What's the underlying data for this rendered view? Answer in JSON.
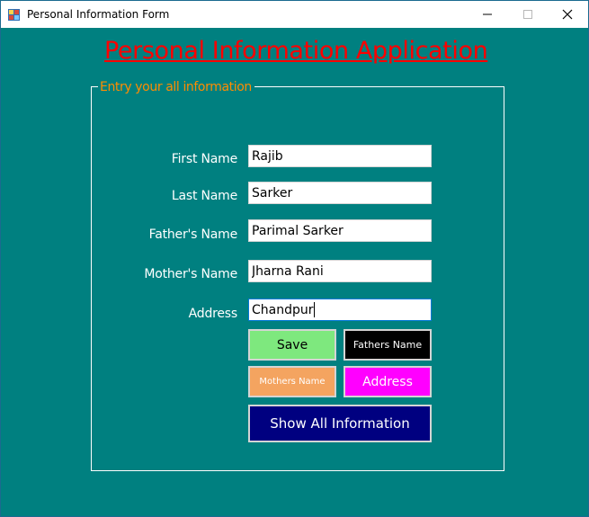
{
  "window": {
    "title": "Personal Information Form",
    "icon": "form-app-icon",
    "controls": {
      "minimize": "minimize-icon",
      "maximize": "maximize-icon",
      "close": "close-icon"
    }
  },
  "header": {
    "title": "Personal Information Application"
  },
  "group": {
    "legend": "Entry your all information"
  },
  "fields": {
    "first_name": {
      "label": "First Name",
      "value": "Rajib"
    },
    "last_name": {
      "label": "Last Name",
      "value": "Sarker"
    },
    "father_name": {
      "label": "Father's Name",
      "value": "Parimal Sarker"
    },
    "mother_name": {
      "label": "Mother's Name",
      "value": "Jharna Rani"
    },
    "address": {
      "label": "Address",
      "value": "Chandpur"
    }
  },
  "buttons": {
    "save": "Save",
    "fathers_name": "Fathers Name",
    "mothers_name": "Mothers Name",
    "address": "Address",
    "show_all": "Show All Information"
  },
  "colors": {
    "form_background": "#008080",
    "title": "#FF0000",
    "legend": "#FF8C00",
    "save_button": "#7EE87E",
    "fathers_button": "#000000",
    "mothers_button": "#F4A460",
    "address_button": "#FF00FF",
    "show_all_button": "#000080"
  }
}
